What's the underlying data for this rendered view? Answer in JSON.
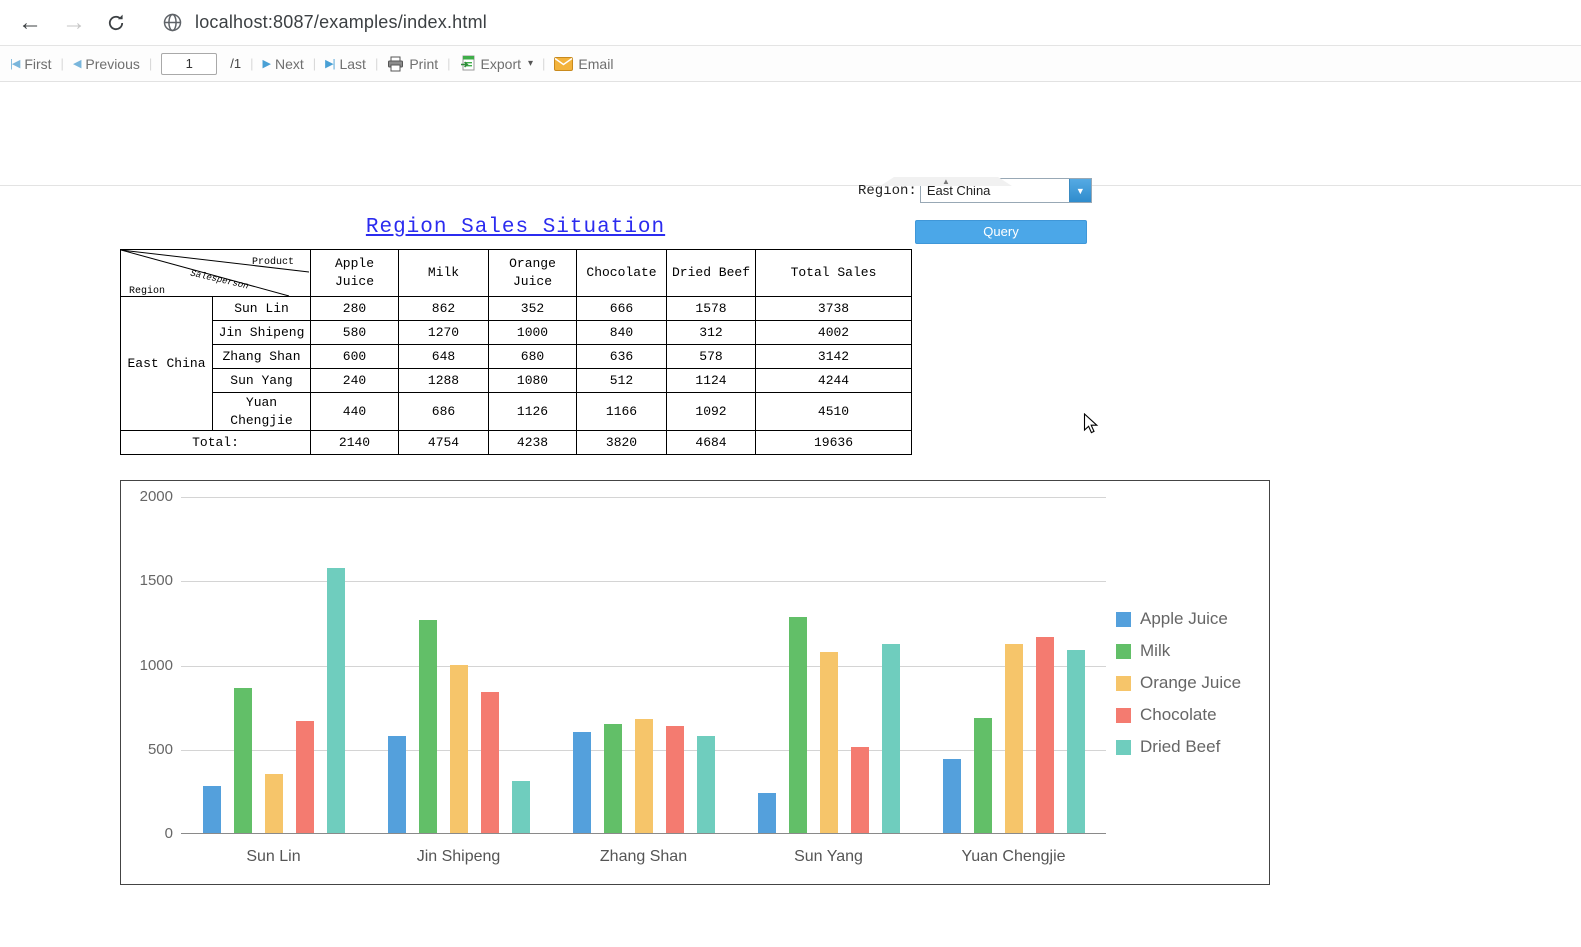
{
  "browser": {
    "url": "localhost:8087/examples/index.html"
  },
  "icons": {
    "back": "←",
    "forward": "→",
    "first": "|◀",
    "previous": "◀",
    "next": "▶",
    "last": "▶|",
    "dropdown_caret": "▼",
    "export_caret": "▾",
    "collapse_caret": "▲",
    "separator": "|"
  },
  "toolbar": {
    "first_label": "First",
    "previous_label": "Previous",
    "page_value": "1",
    "page_total": "/1",
    "next_label": "Next",
    "last_label": "Last",
    "print_label": "Print",
    "export_label": "Export",
    "email_label": "Email"
  },
  "params": {
    "region_label": "Region:",
    "region_value": "East China",
    "query_label": "Query"
  },
  "report": {
    "title": "Region Sales Situation",
    "table": {
      "corner": {
        "top": "Product",
        "middle": "Salesperson",
        "bottom": "Region"
      },
      "columns": [
        "Apple Juice",
        "Milk",
        "Orange Juice",
        "Chocolate",
        "Dried Beef",
        "Total Sales"
      ],
      "region": "East China",
      "rows": [
        {
          "name": "Sun Lin",
          "values": [
            280,
            862,
            352,
            666,
            1578,
            3738
          ]
        },
        {
          "name": "Jin Shipeng",
          "values": [
            580,
            1270,
            1000,
            840,
            312,
            4002
          ]
        },
        {
          "name": "Zhang Shan",
          "values": [
            600,
            648,
            680,
            636,
            578,
            3142
          ]
        },
        {
          "name": "Sun Yang",
          "values": [
            240,
            1288,
            1080,
            512,
            1124,
            4244
          ]
        },
        {
          "name": "Yuan Chengjie",
          "values": [
            440,
            686,
            1126,
            1166,
            1092,
            4510
          ]
        }
      ],
      "total_label": "Total:",
      "totals": [
        2140,
        4754,
        4238,
        3820,
        4684,
        19636
      ]
    }
  },
  "chart_data": {
    "type": "bar",
    "title": "",
    "categories": [
      "Sun Lin",
      "Jin Shipeng",
      "Zhang Shan",
      "Sun Yang",
      "Yuan Chengjie"
    ],
    "series": [
      {
        "name": "Apple Juice",
        "color": "#54a0dc",
        "values": [
          280,
          580,
          600,
          240,
          440
        ]
      },
      {
        "name": "Milk",
        "color": "#62bf68",
        "values": [
          862,
          1270,
          648,
          1288,
          686
        ]
      },
      {
        "name": "Orange Juice",
        "color": "#f6c56a",
        "values": [
          352,
          1000,
          680,
          1080,
          1126
        ]
      },
      {
        "name": "Chocolate",
        "color": "#f47b70",
        "values": [
          666,
          840,
          636,
          512,
          1166
        ]
      },
      {
        "name": "Dried Beef",
        "color": "#6fcdbe",
        "values": [
          1578,
          312,
          578,
          1124,
          1092
        ]
      }
    ],
    "xlabel": "",
    "ylabel": "",
    "ylim": [
      0,
      2000
    ],
    "yticks": [
      0,
      500,
      1000,
      1500,
      2000
    ],
    "grid": true,
    "legend_position": "right"
  }
}
